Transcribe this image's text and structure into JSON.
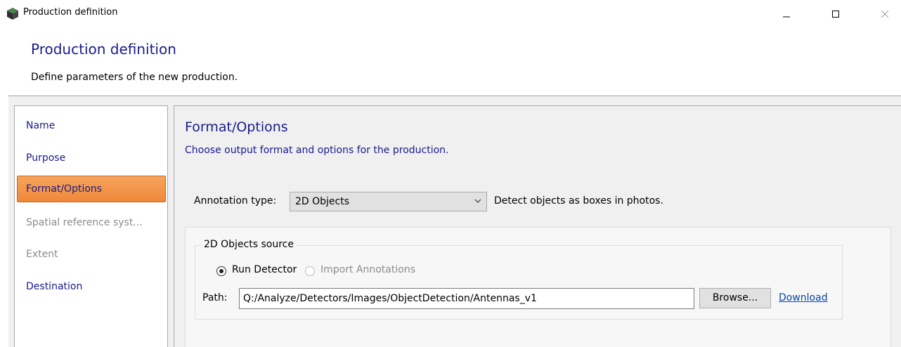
{
  "window": {
    "title": "Production definition",
    "app_icon": "dark-cube-icon",
    "controls": [
      "minimize-icon",
      "maximize-icon",
      "close-icon"
    ]
  },
  "header": {
    "title": "Production definition",
    "description": "Define parameters of the new production."
  },
  "sidebar": {
    "items": [
      {
        "label": "Name",
        "state": "enabled"
      },
      {
        "label": "Purpose",
        "state": "enabled"
      },
      {
        "label": "Format/Options",
        "state": "active"
      },
      {
        "label": "Spatial reference syst...",
        "state": "disabled"
      },
      {
        "label": "Extent",
        "state": "disabled"
      },
      {
        "label": "Destination",
        "state": "enabled"
      }
    ]
  },
  "content": {
    "title": "Format/Options",
    "description": "Choose output format and options for the production.",
    "annotation_type": {
      "label": "Annotation type:",
      "value": "2D Objects",
      "hint": "Detect objects as boxes in photos."
    },
    "source_group": {
      "title": "2D Objects source",
      "options": [
        {
          "label": "Run Detector",
          "checked": true,
          "enabled": true
        },
        {
          "label": "Import Annotations",
          "checked": false,
          "enabled": false
        }
      ],
      "path_label": "Path:",
      "path_value": "Q:/Analyze/Detectors/Images/ObjectDetection/Antennas_v1",
      "browse_label": "Browse...",
      "download_label": "Download"
    }
  },
  "colors": {
    "heading": "#1a1a8c",
    "active_item": "#f0883a",
    "disabled_text": "#8c8c8c",
    "link": "#0645ad"
  }
}
